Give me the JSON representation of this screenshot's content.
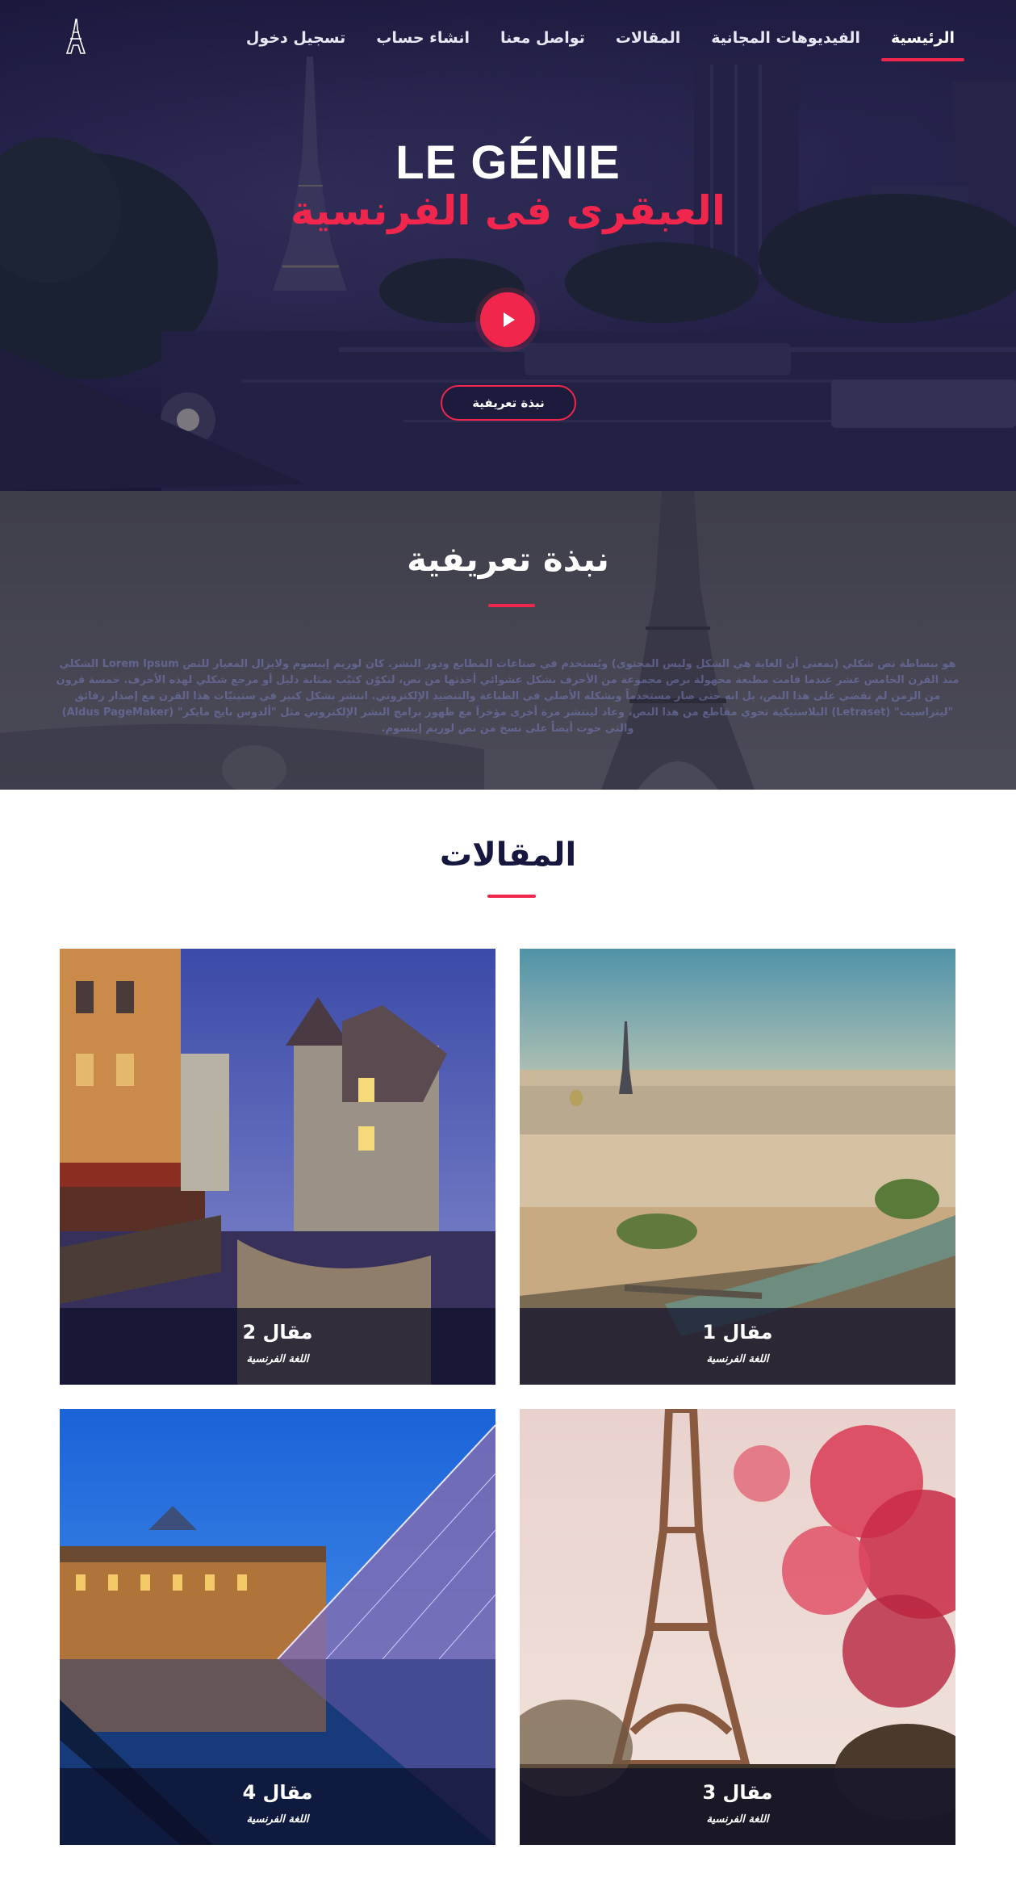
{
  "nav": {
    "items": [
      {
        "label": "الرئيسية",
        "active": true
      },
      {
        "label": "الفيديوهات المجانية",
        "active": false
      },
      {
        "label": "المقالات",
        "active": false
      },
      {
        "label": "تواصل معنا",
        "active": false
      },
      {
        "label": "انشاء حساب",
        "active": false
      },
      {
        "label": "تسجيل دخول",
        "active": false
      }
    ],
    "logo_icon": "eiffel-tower-icon"
  },
  "hero": {
    "title": "LE GÉNIE",
    "subtitle": "العبقرى فى الفرنسية",
    "play_icon": "play-icon",
    "intro_button": "نبذة تعريفية"
  },
  "about": {
    "title": "نبذة تعريفية",
    "text": "هو ببساطة نص شكلي (بمعنى أن الغاية هي الشكل وليس المحتوى) ويُستخدم في صناعات المطابع ودور النشر. كان لوريم إيبسوم ولايزال المعيار للنص Lorem Ipsum الشكلي منذ القرن الخامس عشر عندما قامت مطبعة مجهولة برص مجموعة من الأحرف بشكل عشوائي أخذتها من نص، لتكوّن كتيّب بمثابة دليل أو مرجع شكلي لهذه الأحرف. خمسة قرون من الزمن لم تقضي على هذا النص، بل انه حتى صار مستخدماً وبشكله الأصلي في الطباعة والتنضيد الإلكتروني. انتشر بشكل كبير في ستينيّات هذا القرن مع إصدار رقائق \"ليتراسيت\" (Letraset) البلاستيكية تحوي مقاطع من هذا النص، وعاد لينتشر مرة أخرى مؤخراَ مع ظهور برامج النشر الإلكتروني مثل \"ألدوس بايج مايكر\" (Aldus PageMaker) والتي حوت أيضاً على نسخ من نص لوريم إيبسوم."
  },
  "articles": {
    "title": "المقالات",
    "items": [
      {
        "title": "مقال 1",
        "subtitle": "اللغة الفرنسية",
        "image": "paris-city-view"
      },
      {
        "title": "مقال 2",
        "subtitle": "اللغة الفرنسية",
        "image": "annecy-canal-night"
      },
      {
        "title": "مقال 3",
        "subtitle": "اللغة الفرنسية",
        "image": "eiffel-tower-blossoms"
      },
      {
        "title": "مقال 4",
        "subtitle": "اللغة الفرنسية",
        "image": "louvre-pyramid-dusk"
      }
    ]
  },
  "colors": {
    "accent": "#f0264d",
    "navy": "#16173f",
    "hero_overlay": "#1d1b3f"
  }
}
